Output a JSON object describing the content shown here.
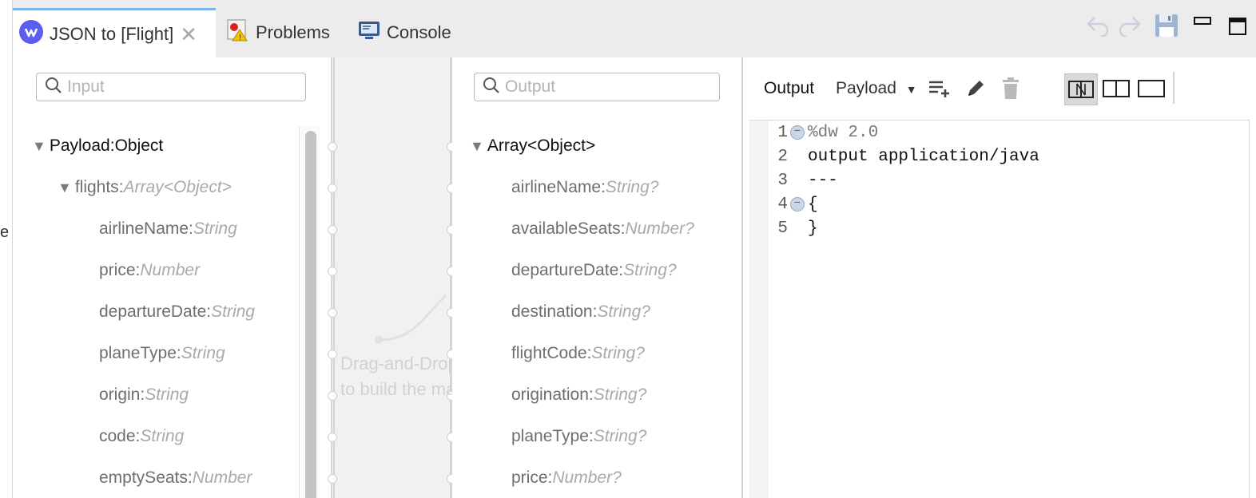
{
  "tabs": [
    {
      "label": "JSON to [Flight]",
      "icon": "dataweave-icon",
      "active": true
    },
    {
      "label": "Problems",
      "icon": "problems-icon",
      "active": false
    },
    {
      "label": "Console",
      "icon": "console-icon",
      "active": false
    }
  ],
  "input_panel": {
    "search_placeholder": "Input",
    "tree": [
      {
        "name": "Payload",
        "sep": " : ",
        "type": "Object",
        "expanded": true
      },
      {
        "name": "flights",
        "sep": " : ",
        "type": "Array<Object>",
        "expanded": true
      },
      {
        "name": "airlineName",
        "sep": " : ",
        "type": "String"
      },
      {
        "name": "price",
        "sep": " : ",
        "type": "Number"
      },
      {
        "name": "departureDate",
        "sep": " : ",
        "type": "String"
      },
      {
        "name": "planeType",
        "sep": " : ",
        "type": "String"
      },
      {
        "name": "origin",
        "sep": " : ",
        "type": "String"
      },
      {
        "name": "code",
        "sep": " : ",
        "type": "String"
      },
      {
        "name": "emptySeats",
        "sep": " : ",
        "type": "Number"
      }
    ]
  },
  "connector": {
    "hint_line1": "Drag-and-Drop",
    "hint_line2": "to build the mapping"
  },
  "output_panel": {
    "search_placeholder": "Output",
    "tree": [
      {
        "name": "Array<Object>",
        "expanded": true
      },
      {
        "name": "airlineName",
        "sep": " : ",
        "type": "String?"
      },
      {
        "name": "availableSeats",
        "sep": " : ",
        "type": "Number?"
      },
      {
        "name": "departureDate",
        "sep": " : ",
        "type": "String?"
      },
      {
        "name": "destination",
        "sep": " : ",
        "type": "String?"
      },
      {
        "name": "flightCode",
        "sep": " : ",
        "type": "String?"
      },
      {
        "name": "origination",
        "sep": " : ",
        "type": "String?"
      },
      {
        "name": "planeType",
        "sep": " : ",
        "type": "String?"
      },
      {
        "name": "price",
        "sep": " : ",
        "type": "Number?"
      }
    ]
  },
  "editor": {
    "output_label": "Output",
    "target_select": "Payload",
    "lines": [
      {
        "n": "1",
        "fold": true,
        "text": "%dw 2.0"
      },
      {
        "n": "2",
        "fold": false,
        "text": "output application/java"
      },
      {
        "n": "3",
        "fold": false,
        "text": "---"
      },
      {
        "n": "4",
        "fold": true,
        "text": "{"
      },
      {
        "n": "5",
        "fold": false,
        "text": "}"
      }
    ]
  },
  "colors": {
    "accent": "#7cb3e8",
    "dataweave_blue": "#5b5ff0"
  }
}
